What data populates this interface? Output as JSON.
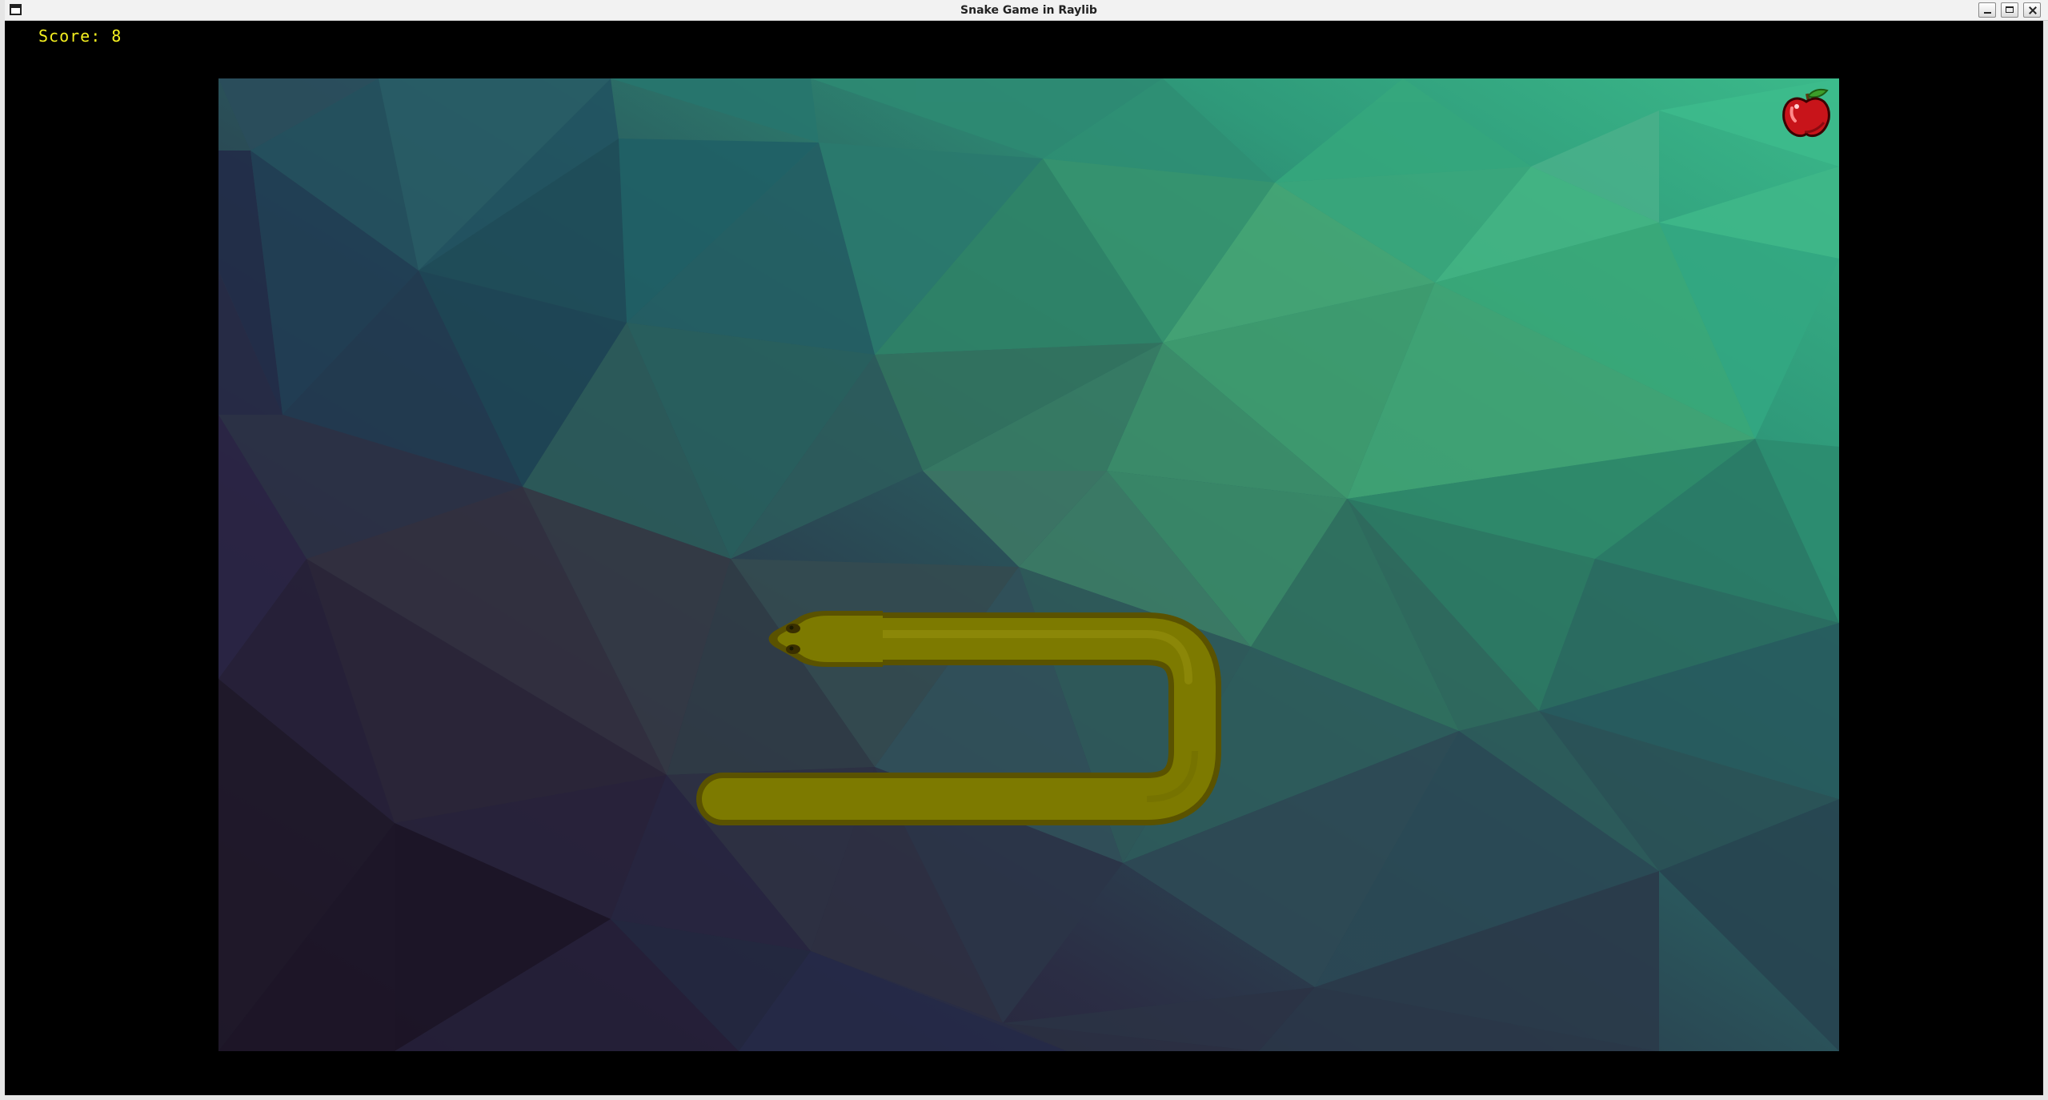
{
  "window": {
    "title": "Snake Game in Raylib"
  },
  "hud": {
    "score_text": "Score: 8",
    "score_color": "#f5f020"
  },
  "game": {
    "background": "low-poly-teal-purple",
    "food_icon": "apple-icon",
    "snake_color": "#7d7a00",
    "snake_direction": "left"
  }
}
